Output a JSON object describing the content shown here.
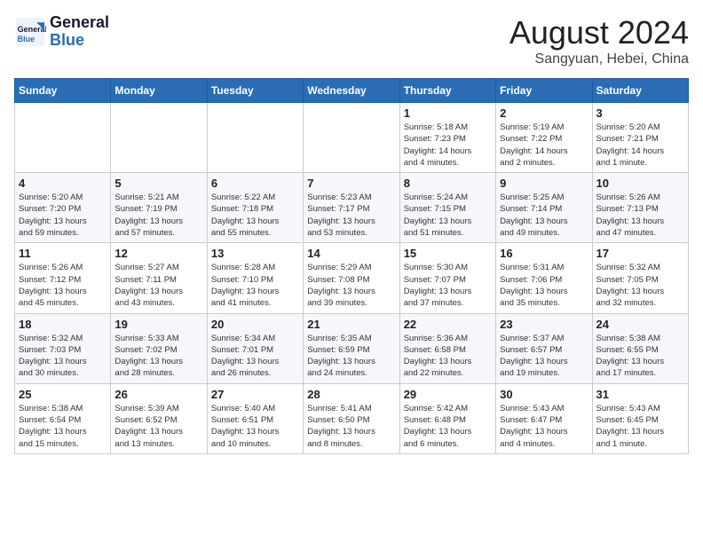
{
  "header": {
    "logo_line1": "General",
    "logo_line2": "Blue",
    "month": "August 2024",
    "location": "Sangyuan, Hebei, China"
  },
  "weekdays": [
    "Sunday",
    "Monday",
    "Tuesday",
    "Wednesday",
    "Thursday",
    "Friday",
    "Saturday"
  ],
  "weeks": [
    [
      {
        "day": "",
        "info": ""
      },
      {
        "day": "",
        "info": ""
      },
      {
        "day": "",
        "info": ""
      },
      {
        "day": "",
        "info": ""
      },
      {
        "day": "1",
        "info": "Sunrise: 5:18 AM\nSunset: 7:23 PM\nDaylight: 14 hours\nand 4 minutes."
      },
      {
        "day": "2",
        "info": "Sunrise: 5:19 AM\nSunset: 7:22 PM\nDaylight: 14 hours\nand 2 minutes."
      },
      {
        "day": "3",
        "info": "Sunrise: 5:20 AM\nSunset: 7:21 PM\nDaylight: 14 hours\nand 1 minute."
      }
    ],
    [
      {
        "day": "4",
        "info": "Sunrise: 5:20 AM\nSunset: 7:20 PM\nDaylight: 13 hours\nand 59 minutes."
      },
      {
        "day": "5",
        "info": "Sunrise: 5:21 AM\nSunset: 7:19 PM\nDaylight: 13 hours\nand 57 minutes."
      },
      {
        "day": "6",
        "info": "Sunrise: 5:22 AM\nSunset: 7:18 PM\nDaylight: 13 hours\nand 55 minutes."
      },
      {
        "day": "7",
        "info": "Sunrise: 5:23 AM\nSunset: 7:17 PM\nDaylight: 13 hours\nand 53 minutes."
      },
      {
        "day": "8",
        "info": "Sunrise: 5:24 AM\nSunset: 7:15 PM\nDaylight: 13 hours\nand 51 minutes."
      },
      {
        "day": "9",
        "info": "Sunrise: 5:25 AM\nSunset: 7:14 PM\nDaylight: 13 hours\nand 49 minutes."
      },
      {
        "day": "10",
        "info": "Sunrise: 5:26 AM\nSunset: 7:13 PM\nDaylight: 13 hours\nand 47 minutes."
      }
    ],
    [
      {
        "day": "11",
        "info": "Sunrise: 5:26 AM\nSunset: 7:12 PM\nDaylight: 13 hours\nand 45 minutes."
      },
      {
        "day": "12",
        "info": "Sunrise: 5:27 AM\nSunset: 7:11 PM\nDaylight: 13 hours\nand 43 minutes."
      },
      {
        "day": "13",
        "info": "Sunrise: 5:28 AM\nSunset: 7:10 PM\nDaylight: 13 hours\nand 41 minutes."
      },
      {
        "day": "14",
        "info": "Sunrise: 5:29 AM\nSunset: 7:08 PM\nDaylight: 13 hours\nand 39 minutes."
      },
      {
        "day": "15",
        "info": "Sunrise: 5:30 AM\nSunset: 7:07 PM\nDaylight: 13 hours\nand 37 minutes."
      },
      {
        "day": "16",
        "info": "Sunrise: 5:31 AM\nSunset: 7:06 PM\nDaylight: 13 hours\nand 35 minutes."
      },
      {
        "day": "17",
        "info": "Sunrise: 5:32 AM\nSunset: 7:05 PM\nDaylight: 13 hours\nand 32 minutes."
      }
    ],
    [
      {
        "day": "18",
        "info": "Sunrise: 5:32 AM\nSunset: 7:03 PM\nDaylight: 13 hours\nand 30 minutes."
      },
      {
        "day": "19",
        "info": "Sunrise: 5:33 AM\nSunset: 7:02 PM\nDaylight: 13 hours\nand 28 minutes."
      },
      {
        "day": "20",
        "info": "Sunrise: 5:34 AM\nSunset: 7:01 PM\nDaylight: 13 hours\nand 26 minutes."
      },
      {
        "day": "21",
        "info": "Sunrise: 5:35 AM\nSunset: 6:59 PM\nDaylight: 13 hours\nand 24 minutes."
      },
      {
        "day": "22",
        "info": "Sunrise: 5:36 AM\nSunset: 6:58 PM\nDaylight: 13 hours\nand 22 minutes."
      },
      {
        "day": "23",
        "info": "Sunrise: 5:37 AM\nSunset: 6:57 PM\nDaylight: 13 hours\nand 19 minutes."
      },
      {
        "day": "24",
        "info": "Sunrise: 5:38 AM\nSunset: 6:55 PM\nDaylight: 13 hours\nand 17 minutes."
      }
    ],
    [
      {
        "day": "25",
        "info": "Sunrise: 5:38 AM\nSunset: 6:54 PM\nDaylight: 13 hours\nand 15 minutes."
      },
      {
        "day": "26",
        "info": "Sunrise: 5:39 AM\nSunset: 6:52 PM\nDaylight: 13 hours\nand 13 minutes."
      },
      {
        "day": "27",
        "info": "Sunrise: 5:40 AM\nSunset: 6:51 PM\nDaylight: 13 hours\nand 10 minutes."
      },
      {
        "day": "28",
        "info": "Sunrise: 5:41 AM\nSunset: 6:50 PM\nDaylight: 13 hours\nand 8 minutes."
      },
      {
        "day": "29",
        "info": "Sunrise: 5:42 AM\nSunset: 6:48 PM\nDaylight: 13 hours\nand 6 minutes."
      },
      {
        "day": "30",
        "info": "Sunrise: 5:43 AM\nSunset: 6:47 PM\nDaylight: 13 hours\nand 4 minutes."
      },
      {
        "day": "31",
        "info": "Sunrise: 5:43 AM\nSunset: 6:45 PM\nDaylight: 13 hours\nand 1 minute."
      }
    ]
  ]
}
